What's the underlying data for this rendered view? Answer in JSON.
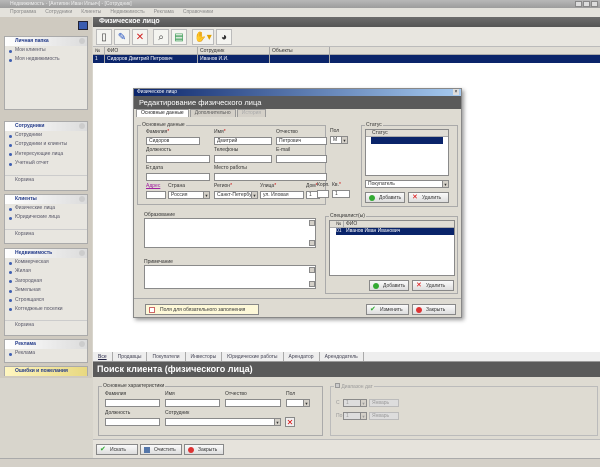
{
  "window": {
    "title": "Недвижимость - [Антипин Иван Ильич] - [Сотрудник]"
  },
  "menu": [
    "Программа",
    "Сотрудники",
    "Клиенты",
    "Недвижимость",
    "Реклама",
    "Справочники"
  ],
  "sidebar": {
    "personal": {
      "title": "Личная папка",
      "items": [
        "Мои клиенты",
        "Моя недвижимость"
      ]
    },
    "staff": {
      "title": "Сотрудники",
      "items": [
        "Сотрудники",
        "Сотрудники и клиенты",
        "Интересующие лица",
        "Учетный отчет"
      ],
      "trash": "Корзина"
    },
    "clients": {
      "title": "Клиенты",
      "items": [
        "Физические лица",
        "Юридические лица"
      ],
      "trash": "Корзина"
    },
    "realty": {
      "title": "Недвижимость",
      "items": [
        "Коммерческая",
        "Жилая",
        "Загородная",
        "Земельная",
        "Строящаяся",
        "Котгеджные поселки"
      ],
      "trash": "Корзина"
    },
    "ads": {
      "title": "Реклама",
      "items": [
        "Реклама"
      ]
    },
    "feedback": {
      "title": "Ошибки и пожелания"
    }
  },
  "main": {
    "title": "Физическое лицо",
    "columns": [
      "№",
      "ФИО",
      "Сотрудник",
      "Объекты"
    ],
    "rows": [
      {
        "num": "1",
        "fio": "Сидоров Дмитрий Петрович",
        "staff": "Иванов И.И.",
        "objects": ""
      }
    ]
  },
  "dialog": {
    "window_title": "Физическое лицо",
    "title": "Редактирование физического лица",
    "tabs": [
      "Основные данные",
      "Дополнительно",
      "История"
    ],
    "basic_group": "Основные данные",
    "fields": {
      "surname": {
        "label": "Фамилия",
        "value": "Сидоров"
      },
      "name": {
        "label": "Имя",
        "value": "Дмитрий"
      },
      "patronymic": {
        "label": "Отчество",
        "value": "Петрович"
      },
      "sex": {
        "label": "Пол",
        "value": "М"
      },
      "position": {
        "label": "Должность",
        "value": ""
      },
      "phone": {
        "label": "Телефоны",
        "value": ""
      },
      "email": {
        "label": "E-mail",
        "value": ""
      },
      "birthdate": {
        "label": "Ет.дата",
        "value": ""
      },
      "workplace": {
        "label": "Место работы",
        "value": ""
      },
      "address": {
        "label": "Адрес"
      },
      "country": {
        "label": "Страна",
        "value": "Россия"
      },
      "region": {
        "label": "Регион",
        "value": "Санкт-Петербург"
      },
      "street": {
        "label": "Улица",
        "value": "ул. Иловая"
      },
      "house": {
        "label": "Дом",
        "value": "1"
      },
      "building": {
        "label": "Корп.",
        "value": ""
      },
      "apartment": {
        "label": "Кв.",
        "value": "1"
      }
    },
    "education_label": "Образование",
    "note_label": "Примечание",
    "status": {
      "group": "Статус",
      "column": "Статус",
      "select": "Покупатель",
      "add": "Добавить",
      "delete": "Удалить"
    },
    "staff": {
      "group": "Специалист(ы)",
      "columns": [
        "№",
        "ФИО"
      ],
      "rows": [
        {
          "num": "01",
          "fio": "Иванов Иван Иванович"
        }
      ],
      "add": "Добавить",
      "delete": "Удалить"
    },
    "required_hint": "Поля для обязательного заполнения",
    "save": "Изменить",
    "close": "Закрыть"
  },
  "bottom_tabs": [
    "Все",
    "Продавцы",
    "Покупатели",
    "Инвесторы",
    "Юридические работы",
    "Арендатор",
    "Арендодатель"
  ],
  "search": {
    "title": "Поиск клиента (физического лица)",
    "group": "Основные характеристики",
    "surname": "Фамилия",
    "name": "Имя",
    "patronymic": "Отчество",
    "sex": "Пол",
    "position": "Должность",
    "staff": "Сотрудник",
    "dates": {
      "label": "Диапазон дат",
      "from": "С",
      "to": "По",
      "day": "1",
      "month": "Январь"
    },
    "find": "Искать",
    "clear": "Очистить",
    "close": "Закрыть"
  }
}
